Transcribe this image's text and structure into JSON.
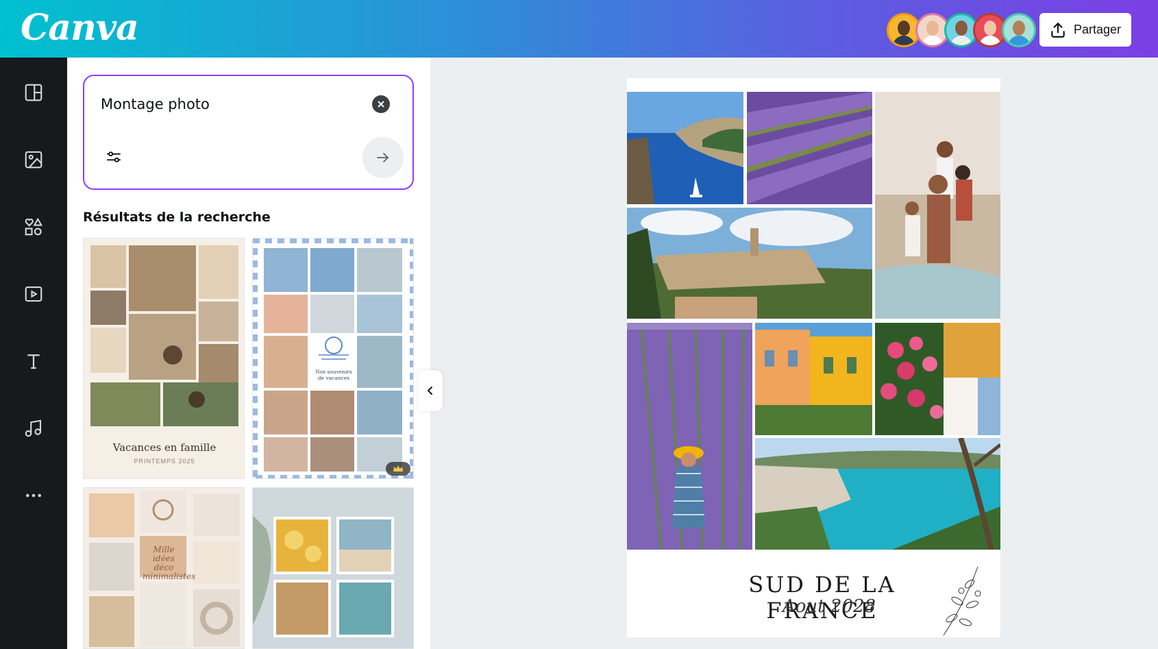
{
  "app": {
    "name": "Canva"
  },
  "header": {
    "logo": "Canva",
    "share_label": "Partager",
    "collaborators": [
      "collaborator-1",
      "collaborator-2",
      "collaborator-3",
      "collaborator-4",
      "collaborator-5"
    ]
  },
  "sidebar": {
    "items": [
      {
        "icon": "layout-icon"
      },
      {
        "icon": "image-icon"
      },
      {
        "icon": "shapes-icon"
      },
      {
        "icon": "video-icon"
      },
      {
        "icon": "text-icon"
      },
      {
        "icon": "music-icon"
      },
      {
        "icon": "more-icon"
      }
    ]
  },
  "search": {
    "value": "Montage photo",
    "clear_icon": "close-icon",
    "filter_icon": "filter-icon",
    "submit_icon": "arrow-right-icon"
  },
  "results": {
    "title": "Résultats de la recherche",
    "templates": [
      {
        "title": "Vacances en famille",
        "subtitle": "PRINTEMPS 2025"
      },
      {
        "title": "Nos souvenirs de vacances",
        "badge": "crown-icon"
      },
      {
        "title": "Mille idées déco minimalistes"
      },
      {
        "title": ""
      }
    ]
  },
  "canvas": {
    "poster_title": "SUD DE LA FRANCE",
    "poster_subtitle": "Aout 2028"
  },
  "colors": {
    "accent": "#8b3dff",
    "rail": "#18191b",
    "gradient_start": "#00c1cf",
    "gradient_end": "#7b3fe4"
  }
}
